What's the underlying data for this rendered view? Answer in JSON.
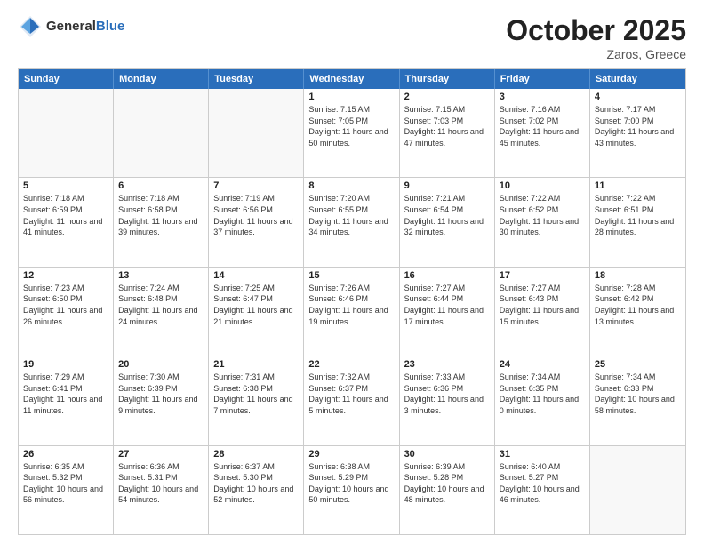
{
  "header": {
    "logo_general": "General",
    "logo_blue": "Blue",
    "month": "October 2025",
    "location": "Zaros, Greece"
  },
  "weekdays": [
    "Sunday",
    "Monday",
    "Tuesday",
    "Wednesday",
    "Thursday",
    "Friday",
    "Saturday"
  ],
  "rows": [
    [
      {
        "day": "",
        "empty": true
      },
      {
        "day": "",
        "empty": true
      },
      {
        "day": "",
        "empty": true
      },
      {
        "day": "1",
        "sunrise": "7:15 AM",
        "sunset": "7:05 PM",
        "daylight": "11 hours and 50 minutes."
      },
      {
        "day": "2",
        "sunrise": "7:15 AM",
        "sunset": "7:03 PM",
        "daylight": "11 hours and 47 minutes."
      },
      {
        "day": "3",
        "sunrise": "7:16 AM",
        "sunset": "7:02 PM",
        "daylight": "11 hours and 45 minutes."
      },
      {
        "day": "4",
        "sunrise": "7:17 AM",
        "sunset": "7:00 PM",
        "daylight": "11 hours and 43 minutes."
      }
    ],
    [
      {
        "day": "5",
        "sunrise": "7:18 AM",
        "sunset": "6:59 PM",
        "daylight": "11 hours and 41 minutes."
      },
      {
        "day": "6",
        "sunrise": "7:18 AM",
        "sunset": "6:58 PM",
        "daylight": "11 hours and 39 minutes."
      },
      {
        "day": "7",
        "sunrise": "7:19 AM",
        "sunset": "6:56 PM",
        "daylight": "11 hours and 37 minutes."
      },
      {
        "day": "8",
        "sunrise": "7:20 AM",
        "sunset": "6:55 PM",
        "daylight": "11 hours and 34 minutes."
      },
      {
        "day": "9",
        "sunrise": "7:21 AM",
        "sunset": "6:54 PM",
        "daylight": "11 hours and 32 minutes."
      },
      {
        "day": "10",
        "sunrise": "7:22 AM",
        "sunset": "6:52 PM",
        "daylight": "11 hours and 30 minutes."
      },
      {
        "day": "11",
        "sunrise": "7:22 AM",
        "sunset": "6:51 PM",
        "daylight": "11 hours and 28 minutes."
      }
    ],
    [
      {
        "day": "12",
        "sunrise": "7:23 AM",
        "sunset": "6:50 PM",
        "daylight": "11 hours and 26 minutes."
      },
      {
        "day": "13",
        "sunrise": "7:24 AM",
        "sunset": "6:48 PM",
        "daylight": "11 hours and 24 minutes."
      },
      {
        "day": "14",
        "sunrise": "7:25 AM",
        "sunset": "6:47 PM",
        "daylight": "11 hours and 21 minutes."
      },
      {
        "day": "15",
        "sunrise": "7:26 AM",
        "sunset": "6:46 PM",
        "daylight": "11 hours and 19 minutes."
      },
      {
        "day": "16",
        "sunrise": "7:27 AM",
        "sunset": "6:44 PM",
        "daylight": "11 hours and 17 minutes."
      },
      {
        "day": "17",
        "sunrise": "7:27 AM",
        "sunset": "6:43 PM",
        "daylight": "11 hours and 15 minutes."
      },
      {
        "day": "18",
        "sunrise": "7:28 AM",
        "sunset": "6:42 PM",
        "daylight": "11 hours and 13 minutes."
      }
    ],
    [
      {
        "day": "19",
        "sunrise": "7:29 AM",
        "sunset": "6:41 PM",
        "daylight": "11 hours and 11 minutes."
      },
      {
        "day": "20",
        "sunrise": "7:30 AM",
        "sunset": "6:39 PM",
        "daylight": "11 hours and 9 minutes."
      },
      {
        "day": "21",
        "sunrise": "7:31 AM",
        "sunset": "6:38 PM",
        "daylight": "11 hours and 7 minutes."
      },
      {
        "day": "22",
        "sunrise": "7:32 AM",
        "sunset": "6:37 PM",
        "daylight": "11 hours and 5 minutes."
      },
      {
        "day": "23",
        "sunrise": "7:33 AM",
        "sunset": "6:36 PM",
        "daylight": "11 hours and 3 minutes."
      },
      {
        "day": "24",
        "sunrise": "7:34 AM",
        "sunset": "6:35 PM",
        "daylight": "11 hours and 0 minutes."
      },
      {
        "day": "25",
        "sunrise": "7:34 AM",
        "sunset": "6:33 PM",
        "daylight": "10 hours and 58 minutes."
      }
    ],
    [
      {
        "day": "26",
        "sunrise": "6:35 AM",
        "sunset": "5:32 PM",
        "daylight": "10 hours and 56 minutes."
      },
      {
        "day": "27",
        "sunrise": "6:36 AM",
        "sunset": "5:31 PM",
        "daylight": "10 hours and 54 minutes."
      },
      {
        "day": "28",
        "sunrise": "6:37 AM",
        "sunset": "5:30 PM",
        "daylight": "10 hours and 52 minutes."
      },
      {
        "day": "29",
        "sunrise": "6:38 AM",
        "sunset": "5:29 PM",
        "daylight": "10 hours and 50 minutes."
      },
      {
        "day": "30",
        "sunrise": "6:39 AM",
        "sunset": "5:28 PM",
        "daylight": "10 hours and 48 minutes."
      },
      {
        "day": "31",
        "sunrise": "6:40 AM",
        "sunset": "5:27 PM",
        "daylight": "10 hours and 46 minutes."
      },
      {
        "day": "",
        "empty": true
      }
    ]
  ]
}
